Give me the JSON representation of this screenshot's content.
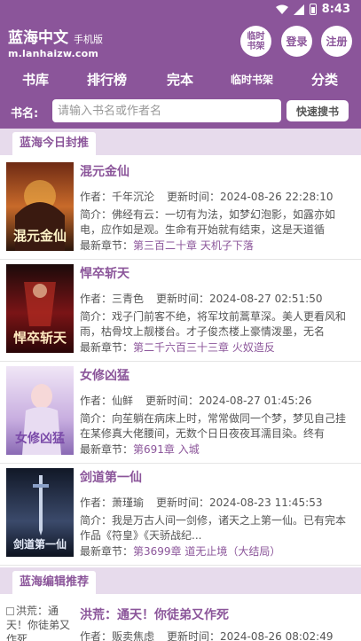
{
  "status": {
    "time": "8:43"
  },
  "header": {
    "site_name": "蓝海中文",
    "site_sub": "手机版",
    "site_url": "m.lanhaizw.com",
    "btn_temp_shelf": "临时书架",
    "btn_login": "登录",
    "btn_register": "注册"
  },
  "nav": {
    "items": [
      "书库",
      "排行榜",
      "完本",
      "临时书架",
      "分类"
    ]
  },
  "search": {
    "label": "书名:",
    "placeholder": "请输入书名或作者名",
    "button": "快速搜书"
  },
  "sections": {
    "top": "蓝海今日封推",
    "editor": "蓝海编辑推荐"
  },
  "books": [
    {
      "title": "混元金仙",
      "author": "作者：千年沉沦",
      "updated": "更新时间：2024-08-26 22:28:10",
      "intro": "简介：佛经有云：一切有为法，如梦幻泡影，如露亦如电，应作如是观。生命有开始就有结束，这是天道循",
      "latest_label": "最新章节：",
      "latest": "第三百二十章 天机子下落",
      "cover_text": "混元金仙"
    },
    {
      "title": "悍卒斩天",
      "author": "作者：三青色",
      "updated": "更新时间：2024-08-27 02:51:50",
      "intro": "简介：戏子门前客不绝，将军坟前蒿草深。美人更看风和雨，枯骨坟上靓楼台。才子俊杰楼上豪情泼墨，无名",
      "latest_label": "最新章节：",
      "latest": "第二千六百三十三章 火奴造反",
      "cover_text": "悍卒斩天"
    },
    {
      "title": "女修凶猛",
      "author": "作者：仙鲜",
      "updated": "更新时间：2024-08-27 01:45:26",
      "intro": "简介：向苼躺在病床上时，常常做同一个梦，梦见自己挂在某修真大佬腰间，无数个日日夜夜耳濡目染。终有",
      "latest_label": "最新章节：",
      "latest": "第691章 入城",
      "cover_text": "女修凶猛"
    },
    {
      "title": "剑道第一仙",
      "author": "作者：萧瑾瑜",
      "updated": "更新时间：2024-08-23 11:45:53",
      "intro": "简介：我是万古人间一剑修，诸天之上第一仙。已有完本作品《符皇》《天骄战纪...",
      "latest_label": "最新章节：",
      "latest": "第3699章 道无止境（大结局）",
      "cover_text": "剑道第一仙"
    }
  ],
  "editor_book": {
    "title": "洪荒：通天！你徒弟又作死",
    "cover_alt": "洪荒：通天！你徒弟又作死",
    "author": "作者：贩卖焦虑",
    "updated": "更新时间：2024-08-26 08:02:49"
  }
}
